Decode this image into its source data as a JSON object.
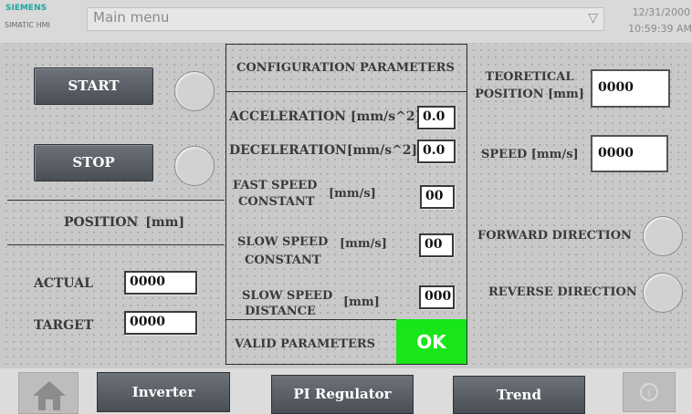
{
  "header": {
    "logo_top": "SIEMENS",
    "logo_bottom": "SIMATIC HMI",
    "menu_value": "Main menu",
    "date": "12/31/2000",
    "time": "10:59:39 AM"
  },
  "left": {
    "start_label": "START",
    "stop_label": "STOP",
    "position_label": "POSITION   [mm]",
    "actual_label": "ACTUAL",
    "actual_value": "0000",
    "target_label": "TARGET",
    "target_value": "0000"
  },
  "config": {
    "title": "CONFIGURATION PARAMETERS",
    "acceleration_label": "ACCELERATION [mm/s^2]",
    "acceleration_value": "0.0",
    "deceleration_label": "DECELERATION[mm/s^2]",
    "deceleration_value": "0.0",
    "fast_speed_label_1": "FAST SPEED",
    "fast_speed_label_2": "CONSTANT",
    "fast_speed_unit": "[mm/s]",
    "fast_speed_value": "00",
    "slow_speed_label_1": "SLOW SPEED",
    "slow_speed_label_2": "CONSTANT",
    "slow_speed_unit": "[mm/s]",
    "slow_speed_value": "00",
    "slow_distance_label_1": "SLOW SPEED",
    "slow_distance_label_2": "DISTANCE",
    "slow_distance_unit": "[mm]",
    "slow_distance_value": "000",
    "valid_label": "VALID PARAMETERS",
    "ok_label": "OK"
  },
  "right": {
    "teoretical_label_1": "TEORETICAL",
    "teoretical_label_2": "POSITION [mm]",
    "teoretical_value": "0000",
    "speed_label": "SPEED [mm/s]",
    "speed_value": "0000",
    "forward_label": "FORWARD DIRECTION",
    "reverse_label": "REVERSE DIRECTION"
  },
  "bottom": {
    "inverter_label": "Inverter",
    "pi_label": "PI Regulator",
    "trend_label": "Trend"
  },
  "colors": {
    "ok_green": "#19e619",
    "button_gray": "#5a5e66"
  }
}
